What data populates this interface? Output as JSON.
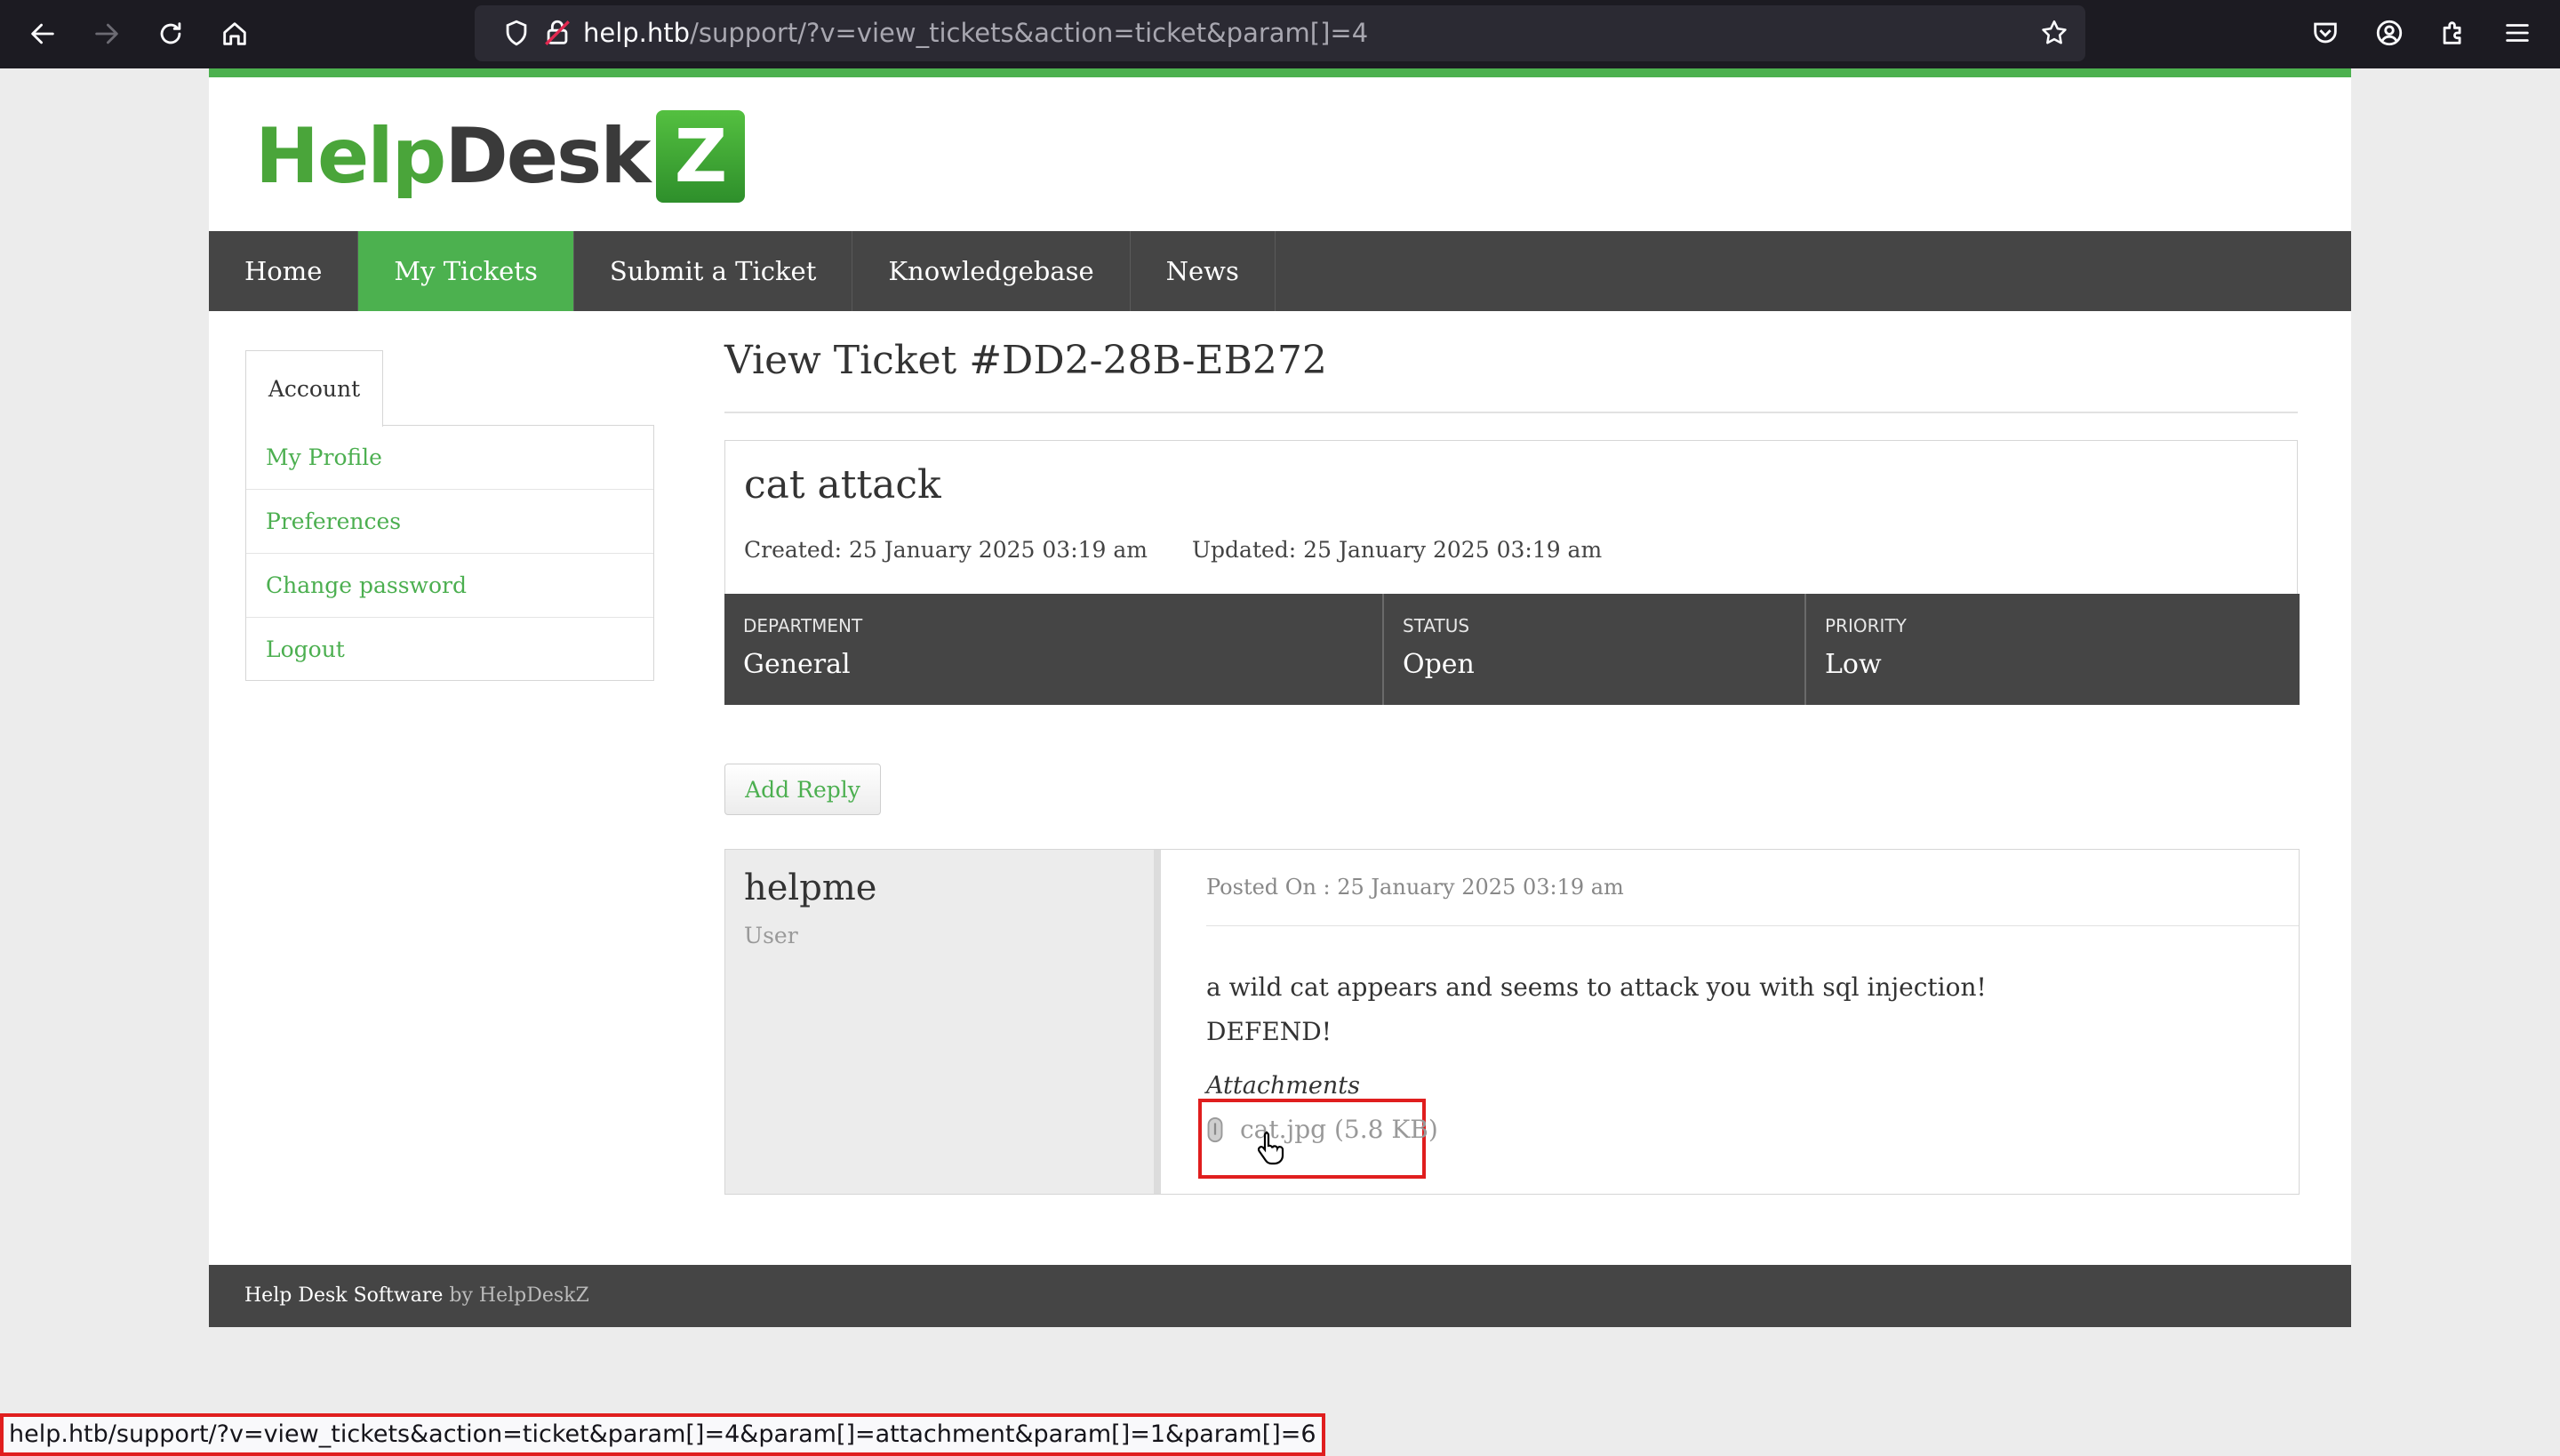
{
  "browser": {
    "url_host": "help.htb",
    "url_path": "/support/?v=view_tickets&action=ticket&param[]=4",
    "status_url": "help.htb/support/?v=view_tickets&action=ticket&param[]=4&param[]=attachment&param[]=1&param[]=6"
  },
  "logo": {
    "help": "Help",
    "desk": "Desk",
    "z": "Z"
  },
  "menu": {
    "items": [
      {
        "label": "Home"
      },
      {
        "label": "My Tickets",
        "active": true
      },
      {
        "label": "Submit a Ticket"
      },
      {
        "label": "Knowledgebase"
      },
      {
        "label": "News"
      }
    ]
  },
  "sidebar": {
    "tab": "Account",
    "links": [
      "My Profile",
      "Preferences",
      "Change password",
      "Logout"
    ]
  },
  "ticket": {
    "page_title": "View Ticket #DD2-28B-EB272",
    "subject": "cat attack",
    "created": "Created: 25 January 2025 03:19 am",
    "updated": "Updated: 25 January 2025 03:19 am",
    "department_label": "DEPARTMENT",
    "department": "General",
    "status_label": "STATUS",
    "status": "Open",
    "priority_label": "PRIORITY",
    "priority": "Low",
    "add_reply": "Add Reply"
  },
  "reply": {
    "username": "helpme",
    "role": "User",
    "posted_on": "Posted On : 25 January 2025 03:19 am",
    "body_line1": "a wild cat appears and seems to attack you with sql injection!",
    "body_line2": "DEFEND!",
    "attachments_label": "Attachments",
    "attachment_name": "cat.jpg",
    "attachment_size": "(5.8 KB)"
  },
  "footer": {
    "software": "Help Desk Software",
    "by": "by HelpDeskZ"
  },
  "colors": {
    "accent": "#4cb14f",
    "dark_bar": "#454545",
    "highlight": "#e01e1e"
  }
}
